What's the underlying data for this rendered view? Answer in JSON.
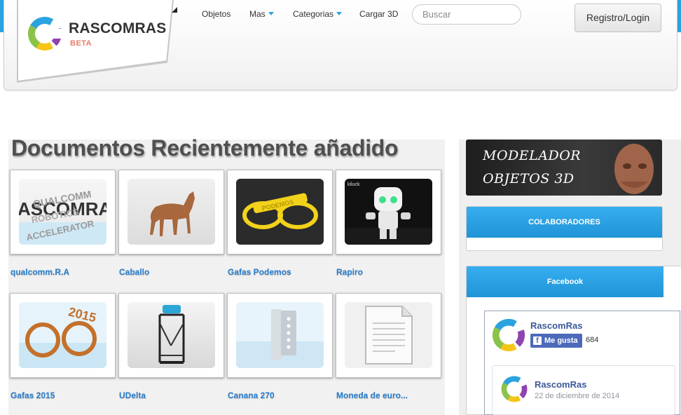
{
  "brand": {
    "name": "RASCOMRAS",
    "tag": "BETA"
  },
  "nav": {
    "items": [
      {
        "label": "Objetos",
        "has_caret": false
      },
      {
        "label": "Mas",
        "has_caret": true
      },
      {
        "label": "Categorias",
        "has_caret": true
      },
      {
        "label": "Cargar 3D",
        "has_caret": false
      }
    ],
    "search_placeholder": "Buscar",
    "login_label": "Registro/Login"
  },
  "main": {
    "title": "Documentos Recientemente añadido",
    "documents": [
      {
        "label": "qualcomm.R.A"
      },
      {
        "label": "Caballo"
      },
      {
        "label": "Gafas Podemos"
      },
      {
        "label": "Rapiro"
      },
      {
        "label": "Gafas 2015"
      },
      {
        "label": "UDelta"
      },
      {
        "label": "Canana 270"
      },
      {
        "label": "Moneda de euro..."
      }
    ]
  },
  "sidebar": {
    "ad": {
      "line1": "MODELADOR",
      "line2": "OBJETOS 3D"
    },
    "collaborators_title": "COLABORADORES",
    "facebook_title": "Facebook",
    "fb": {
      "page_name": "RascomRas",
      "like_label": "Me gusta",
      "like_count": "684",
      "post_author": "RascomRas",
      "post_date": "22 de diciembre de 2014"
    }
  },
  "colors": {
    "accent": "#2ba3e0",
    "link": "#2a7fd0",
    "facebook": "#3b5998"
  }
}
